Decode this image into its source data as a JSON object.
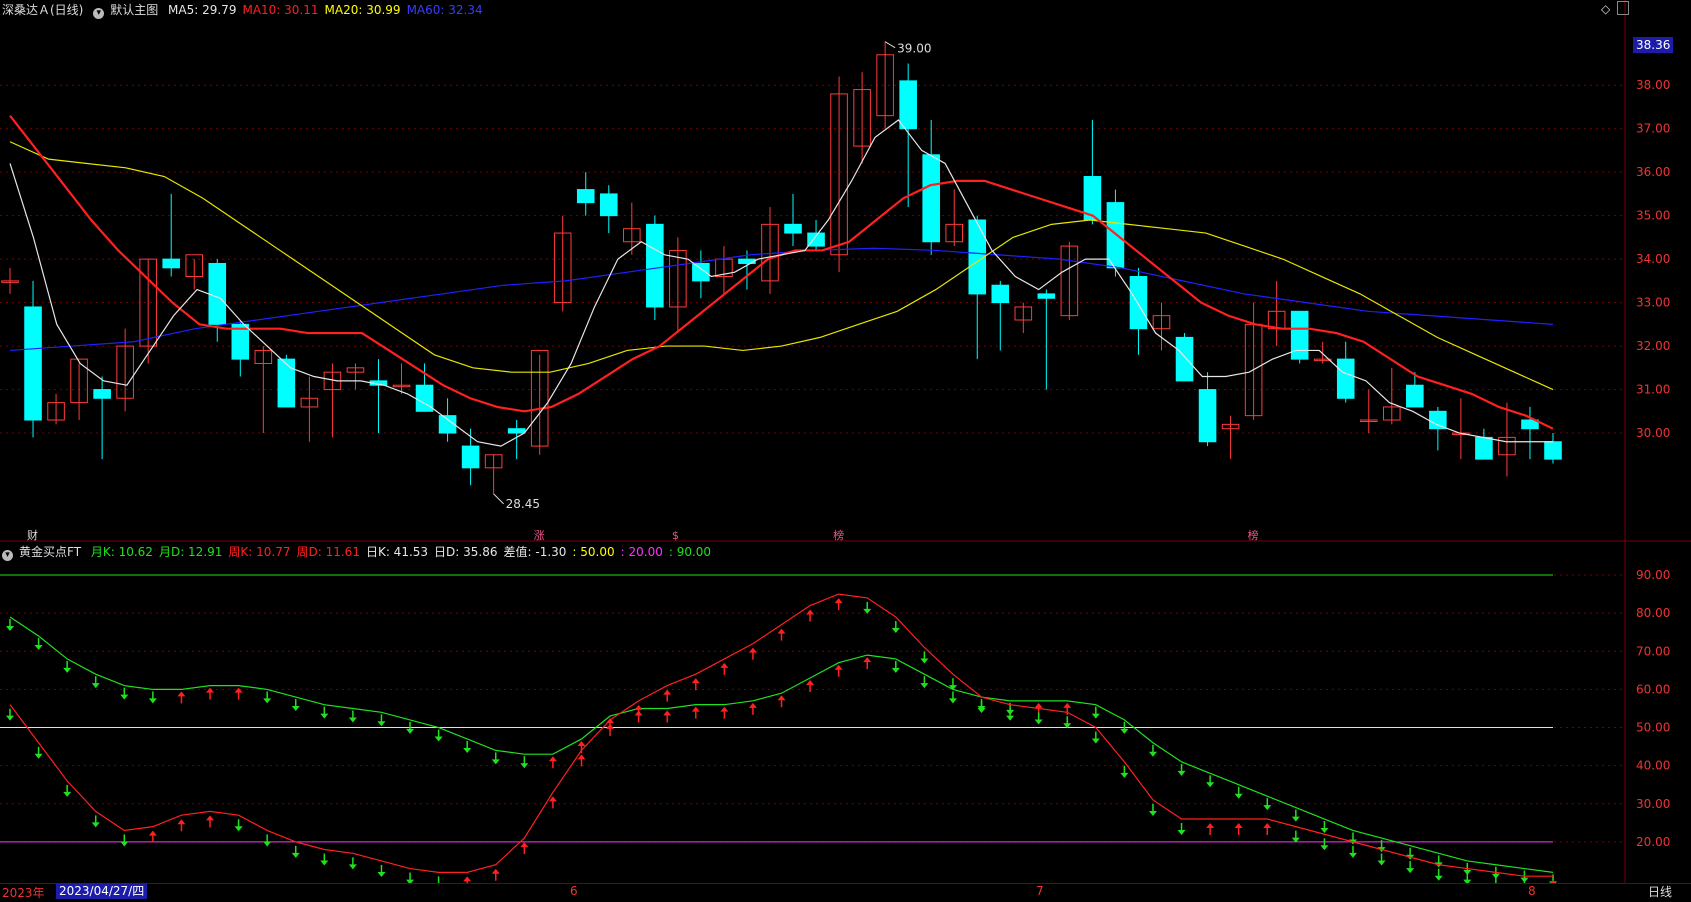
{
  "header_top": {
    "stock": "深桑达Ａ(日线)",
    "main_label": "默认主图",
    "items": [
      {
        "label": "MA5: 29.79",
        "color": "#e6e6e6"
      },
      {
        "label": "MA10: 30.11",
        "color": "#ff2020"
      },
      {
        "label": "MA20: 30.99",
        "color": "#ffff00"
      },
      {
        "label": "MA60: 32.34",
        "color": "#3b3bff"
      }
    ]
  },
  "header_bottom": {
    "indicator": "黄金买点FT",
    "items": [
      {
        "label": "月K: 10.62",
        "color": "#20e020"
      },
      {
        "label": "月D: 12.91",
        "color": "#20e020"
      },
      {
        "label": "周K: 10.77",
        "color": "#ff2020"
      },
      {
        "label": "周D: 11.61",
        "color": "#ff2020"
      },
      {
        "label": "日K: 41.53",
        "color": "#e6e6e6"
      },
      {
        "label": "日D: 35.86",
        "color": "#e6e6e6"
      },
      {
        "label": "差值: -1.30",
        "color": "#e6e6e6"
      },
      {
        "label": ": 50.00",
        "color": "#ffff00"
      },
      {
        "label": ": 20.00",
        "color": "#ff33ff"
      },
      {
        "label": ": 90.00",
        "color": "#20e020"
      }
    ]
  },
  "bottom_bar": {
    "year": "2023年",
    "date": "2023/04/27/四",
    "month_labels": [
      "6",
      "7",
      "8"
    ],
    "period": "日线"
  },
  "current_price": "38.36",
  "colors": {
    "up": "#ff3b3b",
    "down": "#00ffff",
    "ma5": "#e6e6e6",
    "ma10": "#ff2020",
    "ma20": "#e6e600",
    "ma60": "#2020ff",
    "k_month": "#20e020",
    "k_week": "#ff2020",
    "grid": "#7a0000"
  },
  "chart_data": [
    {
      "type": "candlestick",
      "title": "深桑达Ａ(日线)",
      "ylim": [
        28.0,
        39.5
      ],
      "y_ticks": [
        30,
        31,
        32,
        33,
        34,
        35,
        36,
        37,
        38
      ],
      "y_tick_labels": [
        "30.00",
        "31.00",
        "32.00",
        "33.00",
        "34.00",
        "35.00",
        "36.00",
        "37.00",
        "38.00"
      ],
      "high_label": "39.00",
      "low_label": "28.45",
      "event_markers": [
        "财",
        "涨",
        "$",
        "榜",
        "榜"
      ],
      "ohlc": [
        [
          33.5,
          33.8,
          33.2,
          33.5
        ],
        [
          32.9,
          33.5,
          29.9,
          30.3
        ],
        [
          30.3,
          30.9,
          30.2,
          30.7
        ],
        [
          30.7,
          31.6,
          30.3,
          31.7
        ],
        [
          31.0,
          31.3,
          29.4,
          30.8
        ],
        [
          30.8,
          32.4,
          30.5,
          32.0
        ],
        [
          32.0,
          34.0,
          31.6,
          34.0
        ],
        [
          34.0,
          35.5,
          33.6,
          33.8
        ],
        [
          33.6,
          34.0,
          33.3,
          34.1
        ],
        [
          33.9,
          34.0,
          32.1,
          32.5
        ],
        [
          32.5,
          32.6,
          31.3,
          31.7
        ],
        [
          31.6,
          32.0,
          30.0,
          31.9
        ],
        [
          31.7,
          31.8,
          30.6,
          30.6
        ],
        [
          30.6,
          31.3,
          29.8,
          30.8
        ],
        [
          31.0,
          31.6,
          29.9,
          31.4
        ],
        [
          31.4,
          31.6,
          31.0,
          31.5
        ],
        [
          31.2,
          31.7,
          30.0,
          31.1
        ],
        [
          31.1,
          31.6,
          30.9,
          31.1
        ],
        [
          31.1,
          31.6,
          30.5,
          30.5
        ],
        [
          30.4,
          30.8,
          29.8,
          30.0
        ],
        [
          29.7,
          30.1,
          28.8,
          29.2
        ],
        [
          29.2,
          29.5,
          28.6,
          29.5
        ],
        [
          30.1,
          30.3,
          29.4,
          30.0
        ],
        [
          29.7,
          31.8,
          29.5,
          31.9
        ],
        [
          33.0,
          35.0,
          32.8,
          34.6
        ],
        [
          35.6,
          36.0,
          35.0,
          35.3
        ],
        [
          35.5,
          35.7,
          34.6,
          35.0
        ],
        [
          34.4,
          35.3,
          34.1,
          34.7
        ],
        [
          34.8,
          35.0,
          32.6,
          32.9
        ],
        [
          32.9,
          34.5,
          32.3,
          34.2
        ],
        [
          33.9,
          34.2,
          33.1,
          33.5
        ],
        [
          33.6,
          34.3,
          33.2,
          34.0
        ],
        [
          34.0,
          34.2,
          33.3,
          33.9
        ],
        [
          33.5,
          35.2,
          33.2,
          34.8
        ],
        [
          34.8,
          35.5,
          34.3,
          34.6
        ],
        [
          34.6,
          34.9,
          34.2,
          34.3
        ],
        [
          34.1,
          38.2,
          33.7,
          37.8
        ],
        [
          36.6,
          38.3,
          36.2,
          37.9
        ],
        [
          37.3,
          39.0,
          37.0,
          38.7
        ],
        [
          38.1,
          38.5,
          35.2,
          37.0
        ],
        [
          36.4,
          37.2,
          34.1,
          34.4
        ],
        [
          34.4,
          35.6,
          34.3,
          34.8
        ],
        [
          34.9,
          35.0,
          31.7,
          33.2
        ],
        [
          33.4,
          33.5,
          31.9,
          33.0
        ],
        [
          32.6,
          33.0,
          32.3,
          32.9
        ],
        [
          33.2,
          33.3,
          31.0,
          33.1
        ],
        [
          32.7,
          34.4,
          32.6,
          34.3
        ],
        [
          35.9,
          37.2,
          34.8,
          34.9
        ],
        [
          35.3,
          35.6,
          33.6,
          33.8
        ],
        [
          33.6,
          33.8,
          31.8,
          32.4
        ],
        [
          32.4,
          33.0,
          31.9,
          32.7
        ],
        [
          32.2,
          32.3,
          31.2,
          31.2
        ],
        [
          31.0,
          31.4,
          29.7,
          29.8
        ],
        [
          30.1,
          30.4,
          29.4,
          30.2
        ],
        [
          30.4,
          33.0,
          30.3,
          32.5
        ],
        [
          32.4,
          33.5,
          32.0,
          32.8
        ],
        [
          32.8,
          32.8,
          31.6,
          31.7
        ],
        [
          31.7,
          32.1,
          31.6,
          31.7
        ],
        [
          31.7,
          32.1,
          30.7,
          30.8
        ],
        [
          30.3,
          31.0,
          30.0,
          30.3
        ],
        [
          30.3,
          31.5,
          30.2,
          30.6
        ],
        [
          31.1,
          31.4,
          30.7,
          30.6
        ],
        [
          30.5,
          30.6,
          29.6,
          30.1
        ],
        [
          30.0,
          30.8,
          29.4,
          30.0
        ],
        [
          29.9,
          30.1,
          29.4,
          29.4
        ],
        [
          29.5,
          30.7,
          29.0,
          29.9
        ],
        [
          30.3,
          30.6,
          29.4,
          30.1
        ],
        [
          29.8,
          30.0,
          29.3,
          29.4
        ]
      ],
      "ma5": [
        36.2,
        34.5,
        32.5,
        31.6,
        31.2,
        31.1,
        31.9,
        32.7,
        33.3,
        33.1,
        32.5,
        32.0,
        31.5,
        31.3,
        31.2,
        31.2,
        31.1,
        30.9,
        30.6,
        30.2,
        29.8,
        29.7,
        30.0,
        30.7,
        31.6,
        32.9,
        34.0,
        34.4,
        34.1,
        34.0,
        33.6,
        33.7,
        34.0,
        34.1,
        34.2,
        34.9,
        35.8,
        36.8,
        37.2,
        36.5,
        36.2,
        35.2,
        34.2,
        33.6,
        33.3,
        33.7,
        34.0,
        34.0,
        33.2,
        32.3,
        31.9,
        31.3,
        31.3,
        31.4,
        31.7,
        31.9,
        31.9,
        31.4,
        31.2,
        30.7,
        30.5,
        30.2,
        30.0,
        29.9,
        29.8,
        29.8,
        29.8
      ],
      "ma10": [
        37.3,
        36.5,
        35.7,
        34.9,
        34.2,
        33.6,
        33.0,
        32.5,
        32.4,
        32.4,
        32.4,
        32.3,
        32.3,
        32.3,
        31.9,
        31.5,
        31.1,
        30.8,
        30.6,
        30.5,
        30.6,
        30.9,
        31.3,
        31.7,
        32.0,
        32.5,
        33.0,
        33.5,
        34.0,
        34.2,
        34.2,
        34.4,
        34.9,
        35.4,
        35.7,
        35.8,
        35.8,
        35.6,
        35.4,
        35.2,
        35.0,
        34.5,
        34.0,
        33.5,
        33.0,
        32.7,
        32.5,
        32.4,
        32.4,
        32.3,
        32.1,
        31.7,
        31.3,
        31.1,
        30.9,
        30.6,
        30.4,
        30.1
      ],
      "ma20": [
        36.7,
        36.3,
        36.2,
        36.1,
        35.9,
        35.4,
        34.8,
        34.2,
        33.6,
        33.0,
        32.4,
        31.8,
        31.5,
        31.4,
        31.4,
        31.6,
        31.9,
        32.0,
        32.0,
        31.9,
        32.0,
        32.2,
        32.5,
        32.8,
        33.3,
        33.9,
        34.5,
        34.8,
        34.9,
        34.8,
        34.7,
        34.6,
        34.3,
        34.0,
        33.6,
        33.2,
        32.7,
        32.2,
        31.8,
        31.4,
        31.0
      ],
      "ma60": [
        31.9,
        32.0,
        32.1,
        32.4,
        32.6,
        32.8,
        33.0,
        33.2,
        33.4,
        33.5,
        33.7,
        33.9,
        34.1,
        34.2,
        34.25,
        34.2,
        34.1,
        34.0,
        33.8,
        33.5,
        33.2,
        33.0,
        32.8,
        32.7,
        32.6,
        32.5
      ],
      "x_label": "",
      "y_label": ""
    },
    {
      "type": "line",
      "title": "黄金买点FT",
      "ylim": [
        10,
        95
      ],
      "y_ticks": [
        20,
        30,
        40,
        50,
        60,
        70,
        80,
        90
      ],
      "y_tick_labels": [
        "20.00",
        "30.00",
        "40.00",
        "50.00",
        "60.00",
        "70.00",
        "80.00",
        "90.00"
      ],
      "reference_lines": [
        {
          "value": 90,
          "color": "#20e020"
        },
        {
          "value": 50,
          "color": "#ffff00"
        },
        {
          "value": 20,
          "color": "#ff33ff"
        }
      ],
      "series": [
        {
          "name": "月K",
          "color": "#20e020",
          "values": [
            79,
            74,
            68,
            64,
            61,
            60,
            60,
            61,
            61,
            60,
            58,
            56,
            55,
            54,
            52,
            50,
            47,
            44,
            43,
            43,
            47,
            53,
            55,
            55,
            56,
            56,
            57,
            59,
            63,
            67,
            69,
            68,
            64,
            60,
            58,
            57,
            57,
            57,
            56,
            52,
            46,
            41,
            38,
            35,
            32,
            29,
            26,
            23,
            21,
            19,
            17,
            15,
            14,
            13,
            12
          ]
        },
        {
          "name": "周K",
          "color": "#ff2020",
          "values": [
            56,
            46,
            36,
            28,
            23,
            24,
            27,
            28,
            27,
            23,
            20,
            18,
            17,
            15,
            13,
            12,
            12,
            14,
            21,
            33,
            44,
            52,
            57,
            61,
            64,
            68,
            72,
            77,
            82,
            85,
            84,
            79,
            71,
            64,
            58,
            56,
            55,
            54,
            50,
            41,
            31,
            26,
            26,
            26,
            26,
            24,
            22,
            20,
            18,
            16,
            14,
            13,
            12,
            11,
            11
          ]
        }
      ],
      "x_label": "",
      "y_label": ""
    }
  ]
}
